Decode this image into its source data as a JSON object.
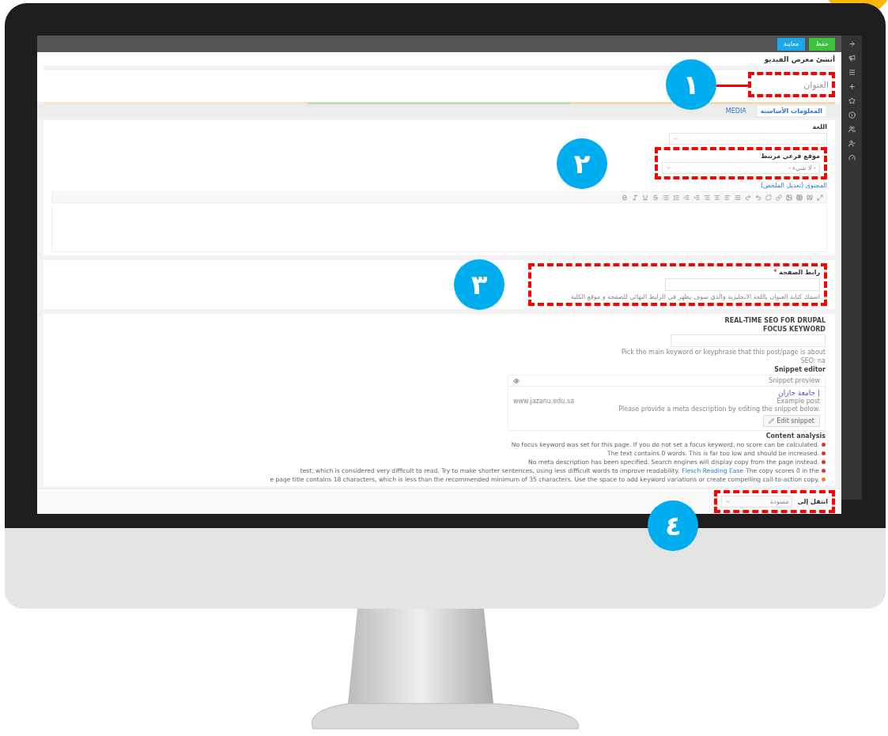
{
  "topbar": {
    "buttons": [
      {
        "label": "حفظ",
        "kind": "primary"
      },
      {
        "label": "معاينة",
        "kind": "secondary"
      }
    ]
  },
  "page_title": "أنشئ معرض الفيديو",
  "title_field": {
    "placeholder": "العنوان"
  },
  "tabs": [
    {
      "label": "المعلومات الأساسية",
      "selected": true
    },
    {
      "label": "MEDIA",
      "selected": false
    }
  ],
  "language": {
    "label": "اللغة"
  },
  "subsite": {
    "label": "موقع فرعي مرتبط",
    "value": "- لا شيء -"
  },
  "content_link": "المحتوى (تعديل الملخص)",
  "url_field": {
    "label": "رابط الصفحة",
    "required_mark": "*",
    "help": "اسمك كتابة العنوان باللغة الانجليزية والذي سوف يظهر في الرابط النهائي للصفحة و موقع الكلية"
  },
  "seo": {
    "heading": "REAL-TIME SEO FOR DRUPAL",
    "focus_label": "FOCUS KEYWORD",
    "focus_help": "Pick the main keyword or keyphrase that this post/page is about",
    "score": "SEO: na",
    "snippet_editor": "Snippet editor",
    "snippet_preview": "Snippet preview",
    "snippet_title": "| جامعة جازان",
    "snippet_path": "Example post",
    "snippet_url": "www.jazanu.edu.sa",
    "snippet_desc": "Please provide a meta description by editing the snippet below.",
    "edit_button": "Edit snippet",
    "analysis_title": "Content analysis",
    "analysis": [
      {
        "text": "No focus keyword was set for this page. If you do not set a focus keyword, no score can be calculated.",
        "color": "#dc3232"
      },
      {
        "text": "The text contains 0 words. This is far too low and should be increased.",
        "color": "#dc3232"
      },
      {
        "text": "No meta description has been specified. Search engines will display copy from the page instead.",
        "color": "#dc3232"
      },
      {
        "text": "The copy scores 0 in the",
        "link": "Flesch Reading Ease",
        "after": "test, which is considered very difficult to read. Try to make shorter sentences, using less difficult words to improve readability.",
        "color": "#dc3232"
      },
      {
        "text": "e page title contains 18 characters, which is less than the recommended minimum of 35 characters. Use the space to add keyword variations or create compelling call-to-action copy.",
        "color": "#ee7c1b"
      }
    ]
  },
  "moderation": {
    "label": "انتقل إلى",
    "value": "مسودة"
  },
  "annotations": [
    {
      "label": "١"
    },
    {
      "label": "٢"
    },
    {
      "label": "٣"
    },
    {
      "label": "٤"
    }
  ]
}
